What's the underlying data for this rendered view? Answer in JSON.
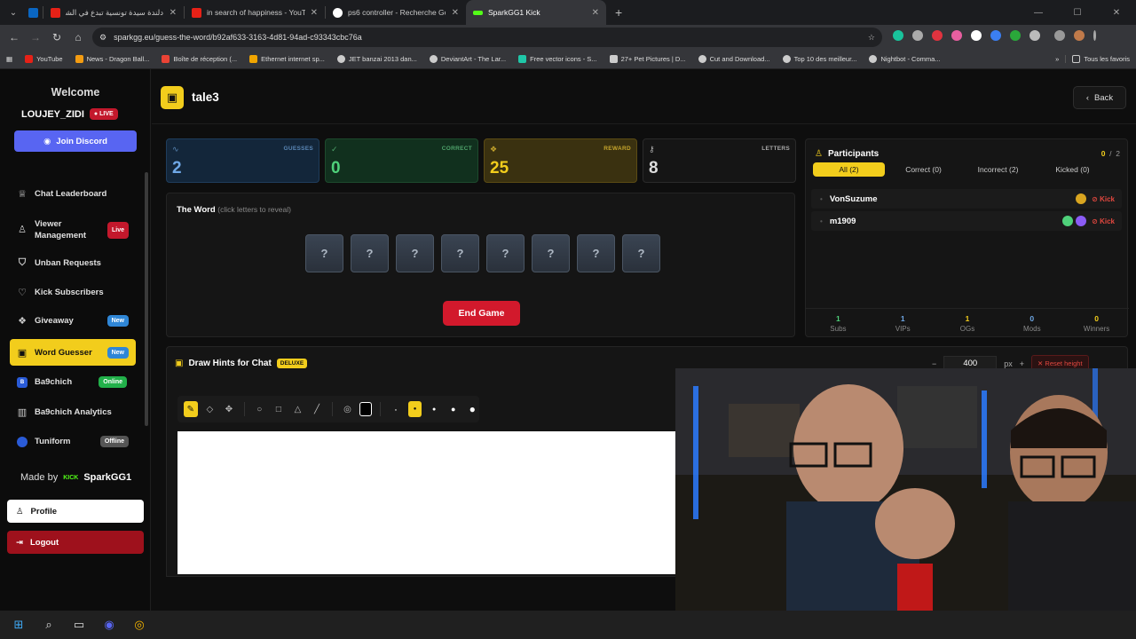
{
  "browser": {
    "tabs": [
      {
        "title": "دلندة سيدة تونسية تبدع في الشا",
        "color": "#e62117"
      },
      {
        "title": "in search of happiness - YouTu",
        "color": "#e62117"
      },
      {
        "title": "ps6 controller - Recherche Goo",
        "color": "#8ab4f8"
      },
      {
        "title": "SparkGG1 Kick",
        "color": "#53fc18"
      }
    ],
    "url": "sparkgg.eu/guess-the-word/b92af633-3163-4d81-94ad-c93343cbc76a",
    "bookmarks": [
      {
        "label": "YouTube",
        "color": "#e62117"
      },
      {
        "label": "News - Dragon Ball...",
        "color": "#f39c12"
      },
      {
        "label": "Boîte de réception (...",
        "color": "#ea4335"
      },
      {
        "label": "Ethernet internet sp...",
        "color": "#f0a500"
      },
      {
        "label": "JET banzai 2013 dan...",
        "color": "#cccccc"
      },
      {
        "label": "DeviantArt - The Lar...",
        "color": "#cccccc"
      },
      {
        "label": "Free vector icons - S...",
        "color": "#1fc7a8"
      },
      {
        "label": "27+ Pet Pictures | D...",
        "color": "#cccccc"
      },
      {
        "label": "Cut and Download...",
        "color": "#cccccc"
      },
      {
        "label": "Top 10 des meilleur...",
        "color": "#cccccc"
      },
      {
        "label": "Nightbot - Comma...",
        "color": "#cccccc"
      }
    ],
    "all_bookmarks": "Tous les favoris"
  },
  "sidebar": {
    "welcome": "Welcome",
    "username": "LOUJEY_ZIDI",
    "live": "LIVE",
    "discord": "Join Discord",
    "items": [
      {
        "label": "Chat Leaderboard"
      },
      {
        "label": "Viewer Management",
        "badge": "Live"
      },
      {
        "label": "Unban Requests"
      },
      {
        "label": "Kick Subscribers"
      },
      {
        "label": "Giveaway",
        "badge": "New"
      },
      {
        "label": "Word Guesser",
        "badge": "New"
      },
      {
        "label": "Ba9chich",
        "badge": "Online"
      },
      {
        "label": "Ba9chich Analytics"
      },
      {
        "label": "Tuniform",
        "badge": "Offline"
      }
    ],
    "made_by": "Made by",
    "made_by_name": "SparkGG1",
    "profile": "Profile",
    "logout": "Logout"
  },
  "header": {
    "title": "tale3",
    "back": "Back"
  },
  "stats": [
    {
      "label": "GUESSES",
      "value": "2"
    },
    {
      "label": "CORRECT",
      "value": "0"
    },
    {
      "label": "REWARD",
      "value": "25"
    },
    {
      "label": "LETTERS",
      "value": "8"
    }
  ],
  "word": {
    "title": "The Word",
    "hint": "(click letters to reveal)",
    "tiles": [
      "?",
      "?",
      "?",
      "?",
      "?",
      "?",
      "?",
      "?"
    ],
    "end": "End Game"
  },
  "participants": {
    "title": "Participants",
    "count": "0",
    "total": "2",
    "tabs": [
      "All (2)",
      "Correct (0)",
      "Incorrect (2)",
      "Kicked (0)"
    ],
    "rows": [
      {
        "name": "VonSuzume",
        "kick": "Kick"
      },
      {
        "name": "m1909",
        "kick": "Kick"
      }
    ],
    "stats": [
      {
        "value": "1",
        "label": "Subs",
        "color": "#4fd17a"
      },
      {
        "value": "1",
        "label": "VIPs",
        "color": "#6fa8e6"
      },
      {
        "value": "1",
        "label": "OGs",
        "color": "#f2cd1c"
      },
      {
        "value": "0",
        "label": "Mods",
        "color": "#6fa8e6"
      },
      {
        "value": "0",
        "label": "Winners",
        "color": "#f2cd1c"
      }
    ]
  },
  "draw": {
    "title": "Draw Hints for Chat",
    "deluxe": "DELUXE",
    "height": "400",
    "unit": "px",
    "reset": "Reset height"
  }
}
